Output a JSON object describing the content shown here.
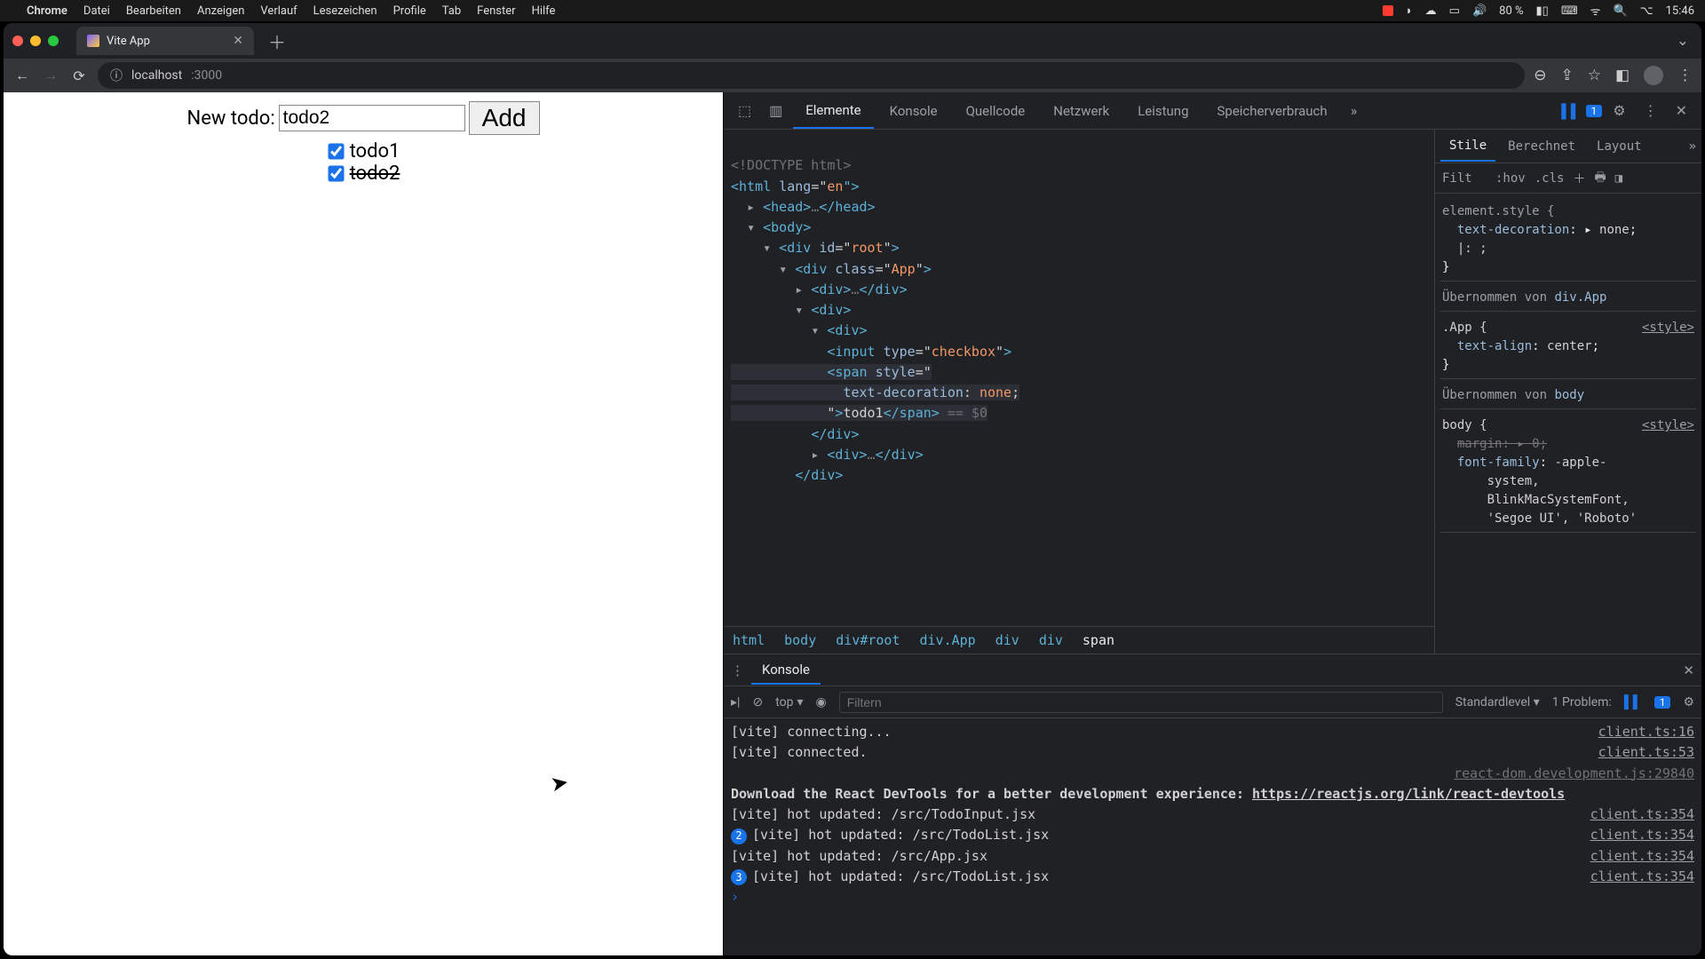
{
  "menubar": {
    "apple": "",
    "app": "Chrome",
    "items": [
      "Datei",
      "Bearbeiten",
      "Anzeigen",
      "Verlauf",
      "Lesezeichen",
      "Profile",
      "Tab",
      "Fenster",
      "Hilfe"
    ],
    "battery": "80 %",
    "time": "15:46"
  },
  "tab": {
    "title": "Vite App"
  },
  "url": {
    "host": "localhost",
    "port": ":3000"
  },
  "app": {
    "label": "New todo:",
    "inputValue": "todo2",
    "addLabel": "Add",
    "todos": [
      {
        "text": "todo1",
        "checked": true,
        "strike": false
      },
      {
        "text": "todo2",
        "checked": true,
        "strike": true
      }
    ]
  },
  "devtools": {
    "tabs": [
      "Elemente",
      "Konsole",
      "Quellcode",
      "Netzwerk",
      "Leistung",
      "Speicherverbrauch"
    ],
    "moreGlyph": "»",
    "issueCount": "1",
    "dom": {
      "l0": "<!DOCTYPE html>",
      "l1a": "<",
      "l1b": "html ",
      "l1c": "lang",
      "l1d": "=\"",
      "l1e": "en",
      "l1f": "\">",
      "l2": "▸ <head>…</head>",
      "l3": "▾ <body>",
      "l4a": "▾ <",
      "l4b": "div ",
      "l4c": "id",
      "l4d": "=\"",
      "l4e": "root",
      "l4f": "\">",
      "l5a": "▾ <",
      "l5b": "div ",
      "l5c": "class",
      "l5d": "=\"",
      "l5e": "App",
      "l5f": "\">",
      "l6": "▸ <div>…</div>",
      "l7": "▾ <div>",
      "l8": "▾ <div>",
      "l9a": "<",
      "l9b": "input ",
      "l9c": "type",
      "l9d": "=\"",
      "l9e": "checkbox",
      "l9f": "\">",
      "l10a": "<",
      "l10b": "span ",
      "l10c": "style",
      "l10d": "=\"",
      "l11": "text-decoration: none;",
      "l12a": "\">",
      "l12b": "todo1",
      "l12c": "</span>",
      "l12d": " == $0",
      "l13": "</div>",
      "l14": "▸ <div>…</div>",
      "l15": "</div>"
    },
    "breadcrumb": [
      "html",
      "body",
      "div#root",
      "div.App",
      "div",
      "div",
      "span"
    ],
    "styles": {
      "tabs": [
        "Stile",
        "Berechnet",
        "Layout"
      ],
      "filterLabel": "Filt",
      "hov": ":hov",
      "cls": ".cls",
      "elementStyle": "element.style {",
      "prop1": "text-decoration",
      "val1": "none",
      "inhFrom": "Übernommen von",
      "inh1": "div.App",
      "appSel": ".App {",
      "styleTag": "<style>",
      "prop2": "text-align",
      "val2": "center",
      "inh2": "body",
      "bodySel": "body {",
      "prop3": "margin",
      "val3": "0",
      "prop4": "font-family",
      "val4a": "-apple-",
      "val4b": "system,",
      "val4c": "BlinkMacSystemFont,",
      "val4d": "'Segoe UI', 'Roboto'"
    }
  },
  "drawer": {
    "title": "Konsole",
    "ctx": "top",
    "filterPlaceholder": "Filtern",
    "level": "Standardlevel",
    "problemsLabel": "1 Problem:",
    "problemsCount": "1",
    "logs": [
      {
        "msg": "[vite] connecting...",
        "src": "client.ts:16"
      },
      {
        "msg": "[vite] connected.",
        "src": "client.ts:53"
      },
      {
        "msg": "",
        "src": "react-dom.development.js:29840",
        "dimsrc": true
      },
      {
        "msg": "Download the React DevTools for a better development experience: ",
        "link": "https://reactjs.org/link/react-devtools",
        "strong": true
      },
      {
        "msg": "[vite] hot updated: /src/TodoInput.jsx",
        "src": "client.ts:354"
      },
      {
        "count": "2",
        "msg": "[vite] hot updated: /src/TodoList.jsx",
        "src": "client.ts:354"
      },
      {
        "msg": "[vite] hot updated: /src/App.jsx",
        "src": "client.ts:354"
      },
      {
        "count": "3",
        "msg": "[vite] hot updated: /src/TodoList.jsx",
        "src": "client.ts:354"
      }
    ],
    "prompt": "›"
  }
}
